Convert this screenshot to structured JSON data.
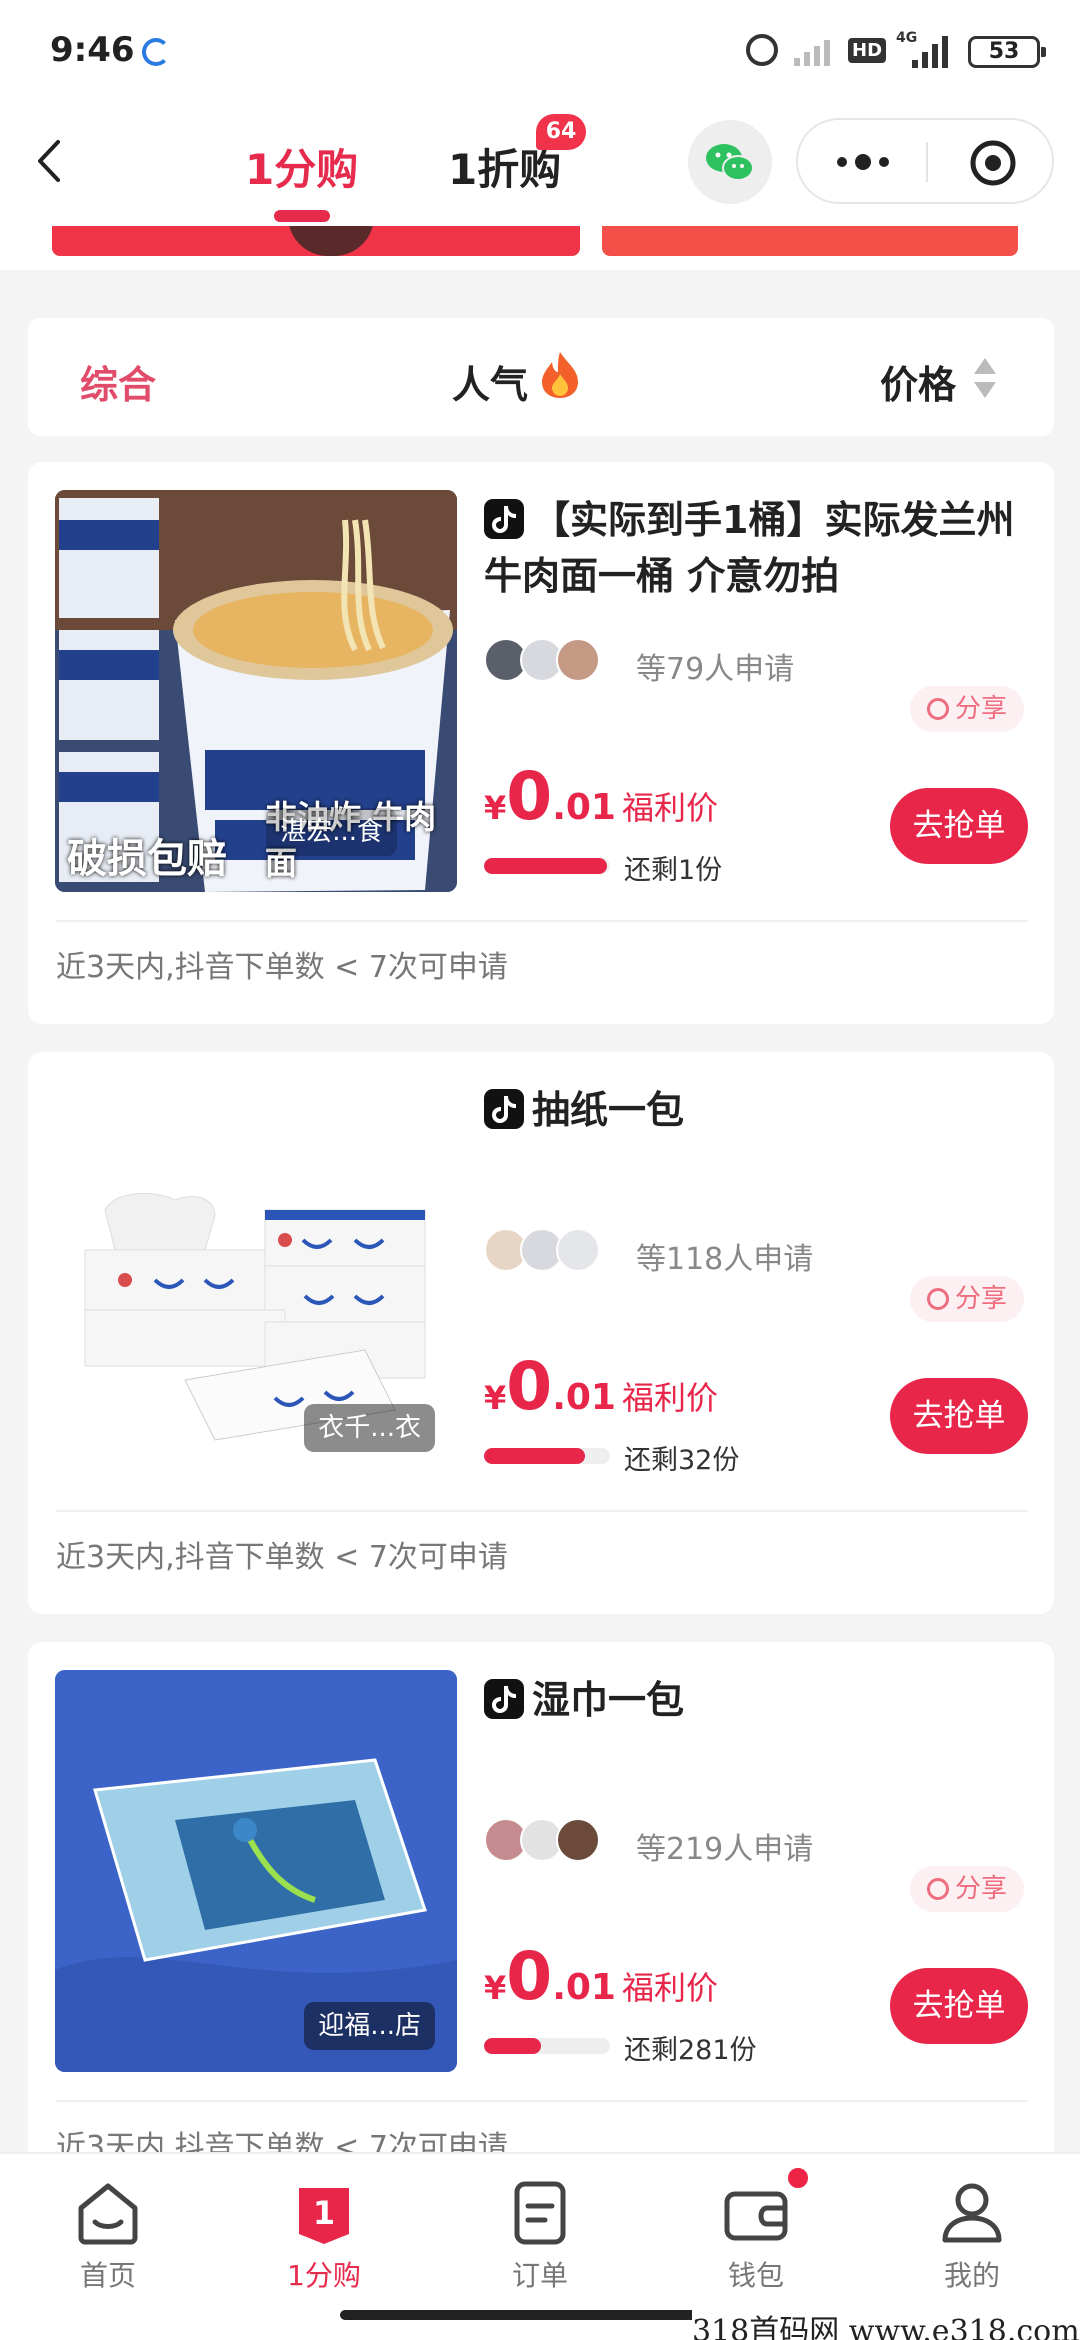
{
  "status_bar": {
    "time": "9:46",
    "network": "4G",
    "hd": "HD",
    "battery": "53"
  },
  "header": {
    "tabs": [
      {
        "label": "1分购",
        "active": true
      },
      {
        "label": "1折购",
        "badge": "64"
      }
    ]
  },
  "sort_bar": {
    "general": "综合",
    "popularity": "人气",
    "price": "价格"
  },
  "products": [
    {
      "title": "【实际到手1桶】实际发兰州牛肉面一桶 介意勿拍",
      "applicants": "等79人申请",
      "share": "分享",
      "price_currency": "¥",
      "price_int": "0",
      "price_dec": ".01",
      "price_label": "福利价",
      "remaining": "还剩1份",
      "stock_level": 0.98,
      "button": "去抢单",
      "rule": "近3天内,抖音下单数 < 7次可申请",
      "promo_left": "破损包赔",
      "promo_right": "非油炸 牛肉面",
      "store": "湛宏...食"
    },
    {
      "title": "抽纸一包",
      "applicants": "等118人申请",
      "share": "分享",
      "price_currency": "¥",
      "price_int": "0",
      "price_dec": ".01",
      "price_label": "福利价",
      "remaining": "还剩32份",
      "stock_level": 0.8,
      "button": "去抢单",
      "rule": "近3天内,抖音下单数 < 7次可申请",
      "store": "衣千...衣"
    },
    {
      "title": "湿巾一包",
      "applicants": "等219人申请",
      "share": "分享",
      "price_currency": "¥",
      "price_int": "0",
      "price_dec": ".01",
      "price_label": "福利价",
      "remaining": "还剩281份",
      "stock_level": 0.45,
      "button": "去抢单",
      "rule": "近3天内,抖音下单数 < 7次可申请",
      "store": "迎福...店"
    }
  ],
  "bottom_nav": [
    {
      "label": "首页",
      "icon": "home-icon"
    },
    {
      "label": "1分购",
      "icon": "one-cent-icon",
      "active": true
    },
    {
      "label": "订单",
      "icon": "order-icon"
    },
    {
      "label": "钱包",
      "icon": "wallet-icon",
      "dot": true
    },
    {
      "label": "我的",
      "icon": "profile-icon"
    }
  ],
  "watermark": "318首码网 www.e318.com",
  "colors": {
    "accent": "#e8264a",
    "accent_text": "#e62b4c"
  }
}
